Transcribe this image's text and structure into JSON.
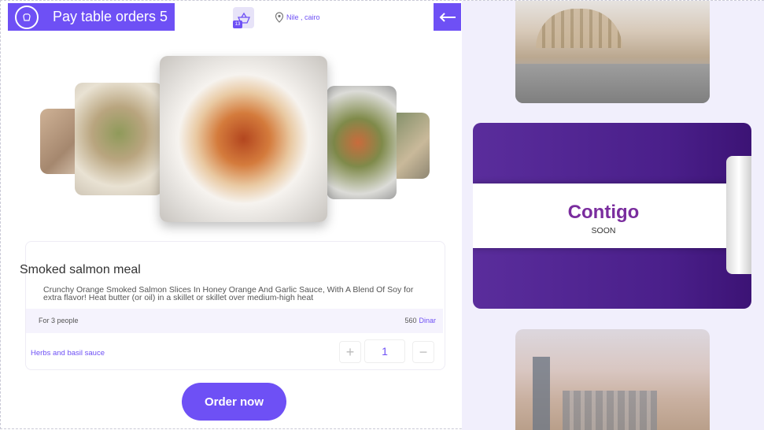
{
  "header": {
    "title": "Pay table orders 5",
    "cart_badge": "13",
    "location": "Nile , cairo"
  },
  "meal": {
    "name": "Smoked salmon meal",
    "description": "Crunchy Orange Smoked Salmon Slices In Honey Orange And Garlic Sauce, With A Blend Of Soy for extra flavor! Heat butter (or oil) in a skillet or skillet over medium-high heat",
    "people": "For 3 people",
    "price": "560",
    "currency": "Dinar",
    "addon": "Herbs and basil sauce",
    "quantity": "1",
    "plus_label": "+",
    "minus_label": "−",
    "order_label": "Order now"
  },
  "promo": {
    "brand": "Contigo",
    "tagline": "SOON"
  },
  "colors": {
    "accent": "#6e50f5",
    "promo_bg": "#4a1f8a",
    "panel_bg": "#f1effc"
  }
}
